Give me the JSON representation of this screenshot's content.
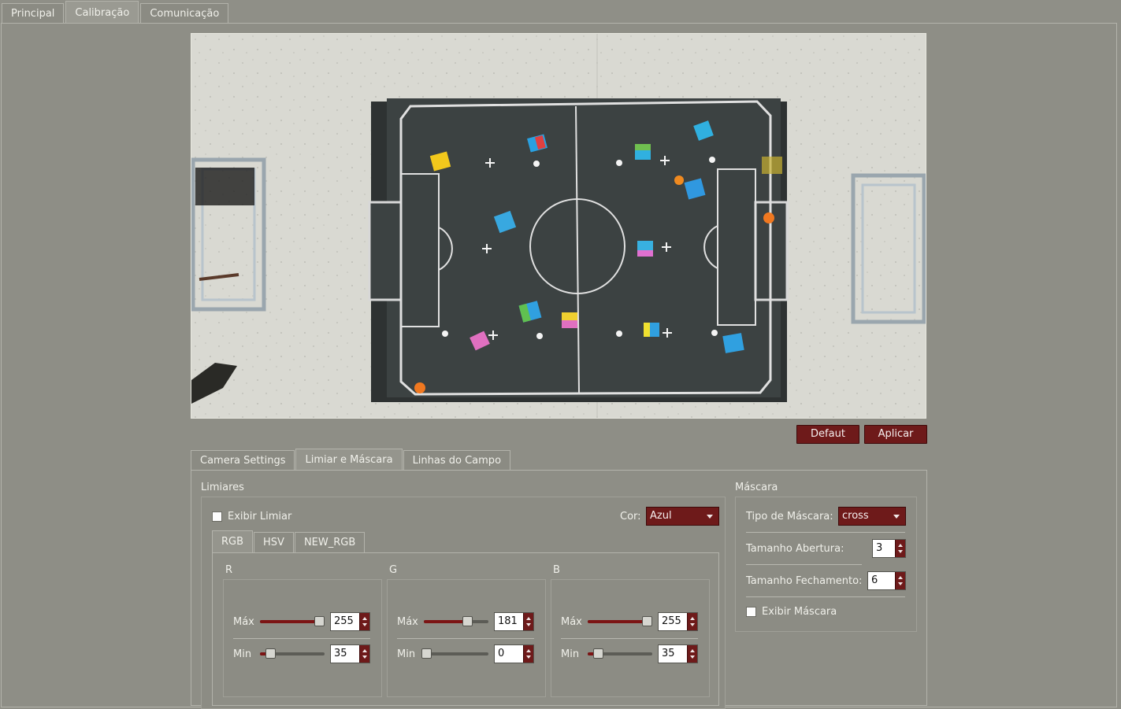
{
  "main_tabs": [
    "Principal",
    "Calibração",
    "Comunicação"
  ],
  "buttons": {
    "default": "Defaut",
    "apply": "Aplicar"
  },
  "sub_tabs": [
    "Camera Settings",
    "Limiar e Máscara",
    "Linhas do Campo"
  ],
  "thresholds": {
    "title": "Limiares",
    "show_label": "Exibir Limiar",
    "color_label": "Cor:",
    "color_value": "Azul",
    "tabs": [
      "RGB",
      "HSV",
      "NEW_RGB"
    ],
    "max_label": "Máx",
    "min_label": "Min",
    "channels": [
      {
        "name": "R",
        "max": "255",
        "min": "35",
        "max_frac": 0.92,
        "min_frac": 0.16
      },
      {
        "name": "G",
        "max": "181",
        "min": "0",
        "max_frac": 0.67,
        "min_frac": 0.04
      },
      {
        "name": "B",
        "max": "255",
        "min": "35",
        "max_frac": 0.92,
        "min_frac": 0.16
      }
    ]
  },
  "mask": {
    "title": "Máscara",
    "type_label": "Tipo de Máscara:",
    "type_value": "cross",
    "opening_label": "Tamanho Abertura:",
    "opening_value": "3",
    "closing_label": "Tamanho Fechamento:",
    "closing_value": "6",
    "show_label": "Exibir Máscara"
  },
  "colors": {
    "accent": "#6e1a1a",
    "panel": "#8e8e86",
    "field": "#3c4242"
  }
}
